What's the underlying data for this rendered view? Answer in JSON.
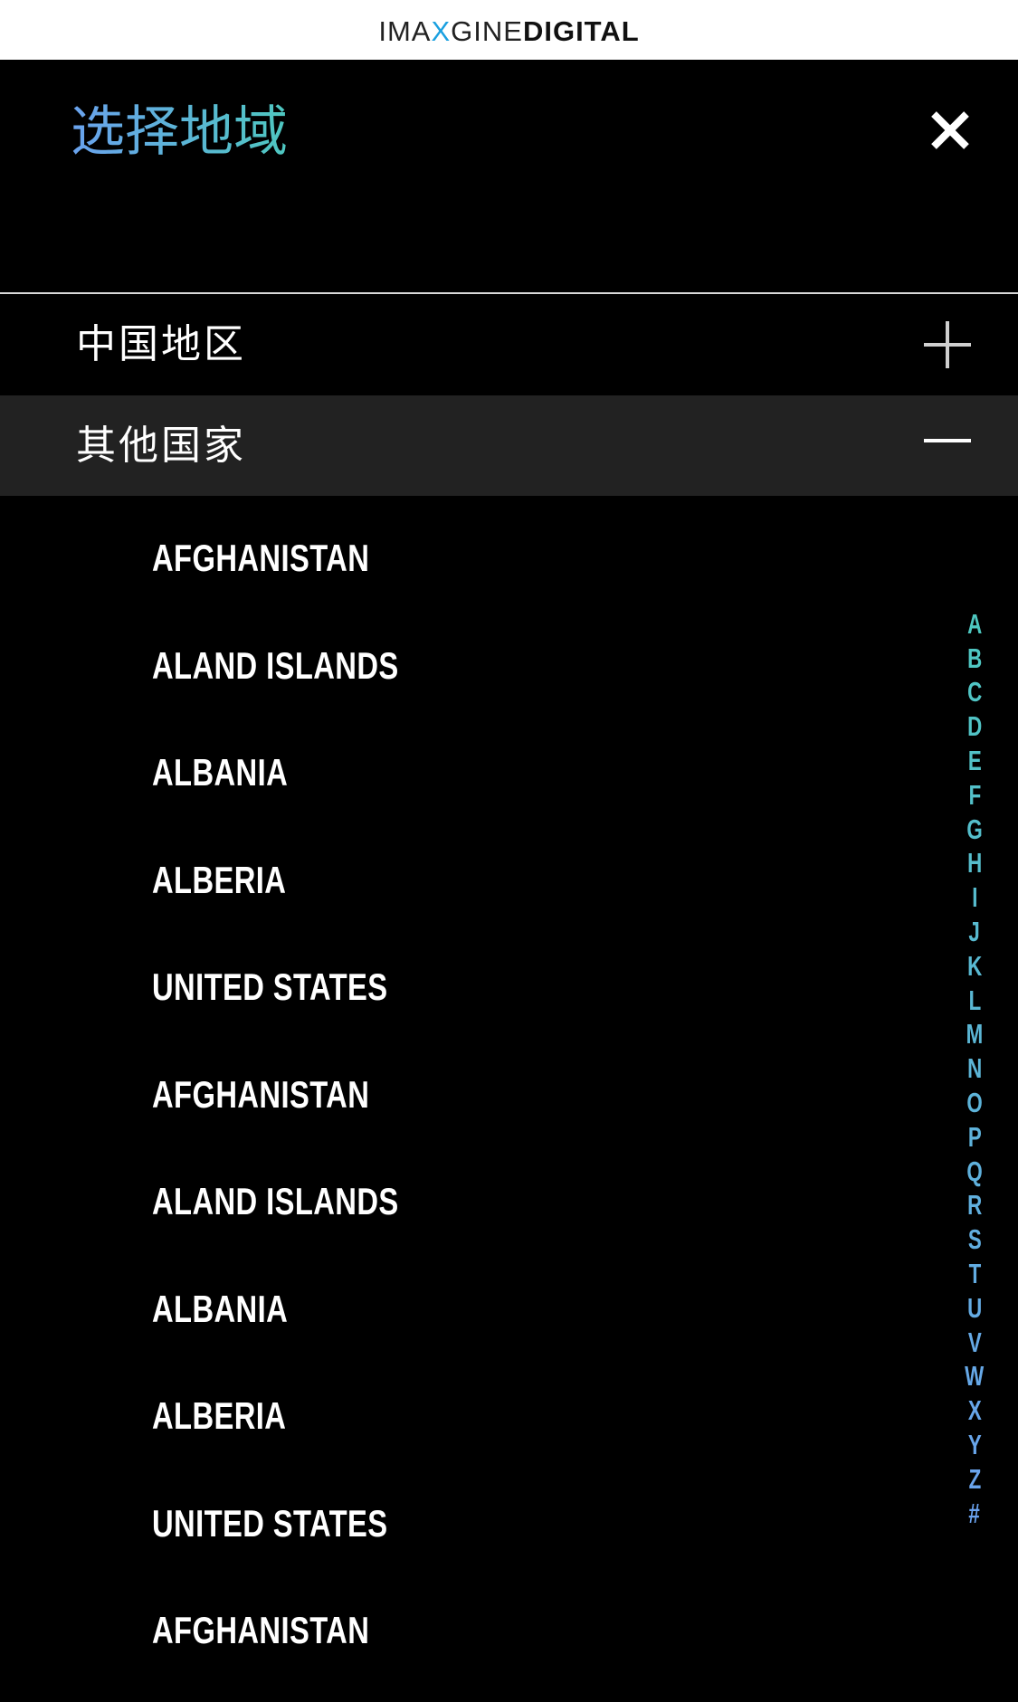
{
  "brand": {
    "part1": "IMA",
    "part2": "X",
    "part3": "GINE",
    "part4": "DIGITAL"
  },
  "modal": {
    "title": "选择地域",
    "close_icon": "close-icon"
  },
  "regions": [
    {
      "label": "中国地区",
      "toggle_icon": "plus-icon",
      "expanded": false
    },
    {
      "label": "其他国家",
      "toggle_icon": "minus-icon",
      "expanded": true
    }
  ],
  "countries": [
    "AFGHANISTAN",
    "ALAND ISLANDS",
    "ALBANIA",
    "ALBERIA",
    "UNITED STATES",
    "AFGHANISTAN",
    "ALAND ISLANDS",
    "ALBANIA",
    "ALBERIA",
    "UNITED STATES",
    "AFGHANISTAN"
  ],
  "alpha_index": [
    "A",
    "B",
    "C",
    "D",
    "E",
    "F",
    "G",
    "H",
    "I",
    "J",
    "K",
    "L",
    "M",
    "N",
    "O",
    "P",
    "Q",
    "R",
    "S",
    "T",
    "U",
    "V",
    "W",
    "X",
    "Y",
    "Z",
    "#"
  ],
  "colors": {
    "gradient_start": "#4ec7c0",
    "gradient_end": "#6aa2ee",
    "brand_accent": "#1aa0e0",
    "selected_row_bg": "#222222"
  }
}
